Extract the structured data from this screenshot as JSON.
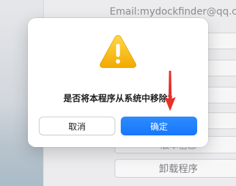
{
  "background": {
    "email_text": "Email:mydockfinder@qq.c",
    "partial_button_label": "版本信息",
    "uninstall_button_label": "卸载程序"
  },
  "dialog": {
    "icon": "warning-triangle-icon",
    "message": "是否将本程序从系统中移除?",
    "cancel_label": "取消",
    "confirm_label": "确定"
  },
  "annotation": {
    "icon": "red-arrow-down-icon",
    "color": "#e8312a"
  },
  "colors": {
    "accent": "#1677fa",
    "warning_yellow": "#f5b400"
  }
}
